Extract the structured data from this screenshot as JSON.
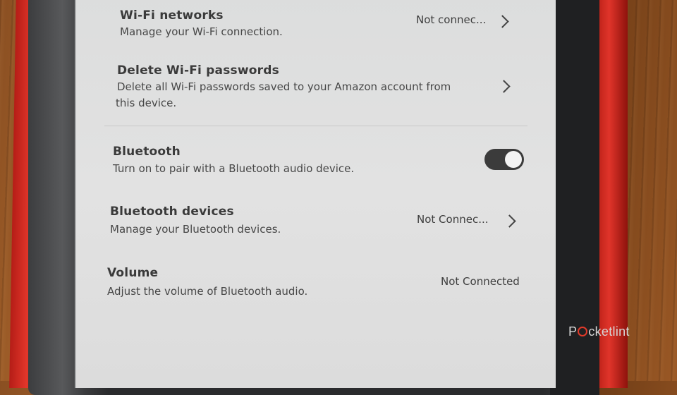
{
  "settings": {
    "wifi_networks": {
      "title": "Wi-Fi networks",
      "description": "Manage your Wi-Fi connection.",
      "value": "Not connec..."
    },
    "delete_wifi": {
      "title": "Delete Wi-Fi passwords",
      "description_line1": "Delete all Wi-Fi passwords saved to your Amazon account from",
      "description_line2": "this device."
    },
    "bluetooth": {
      "title": "Bluetooth",
      "description": "Turn on to pair with a Bluetooth audio device.",
      "toggle_state": "on"
    },
    "bluetooth_devices": {
      "title": "Bluetooth devices",
      "description": "Manage your Bluetooth devices.",
      "value": "Not Connec..."
    },
    "volume": {
      "title": "Volume",
      "description": "Adjust the volume of Bluetooth audio.",
      "value": "Not Connected"
    }
  },
  "watermark": {
    "prefix": "P",
    "suffix": "cketlint"
  },
  "colors": {
    "case": "#e2362a",
    "screen": "#dfdfdf",
    "toggle_track": "#3b3b3b"
  }
}
